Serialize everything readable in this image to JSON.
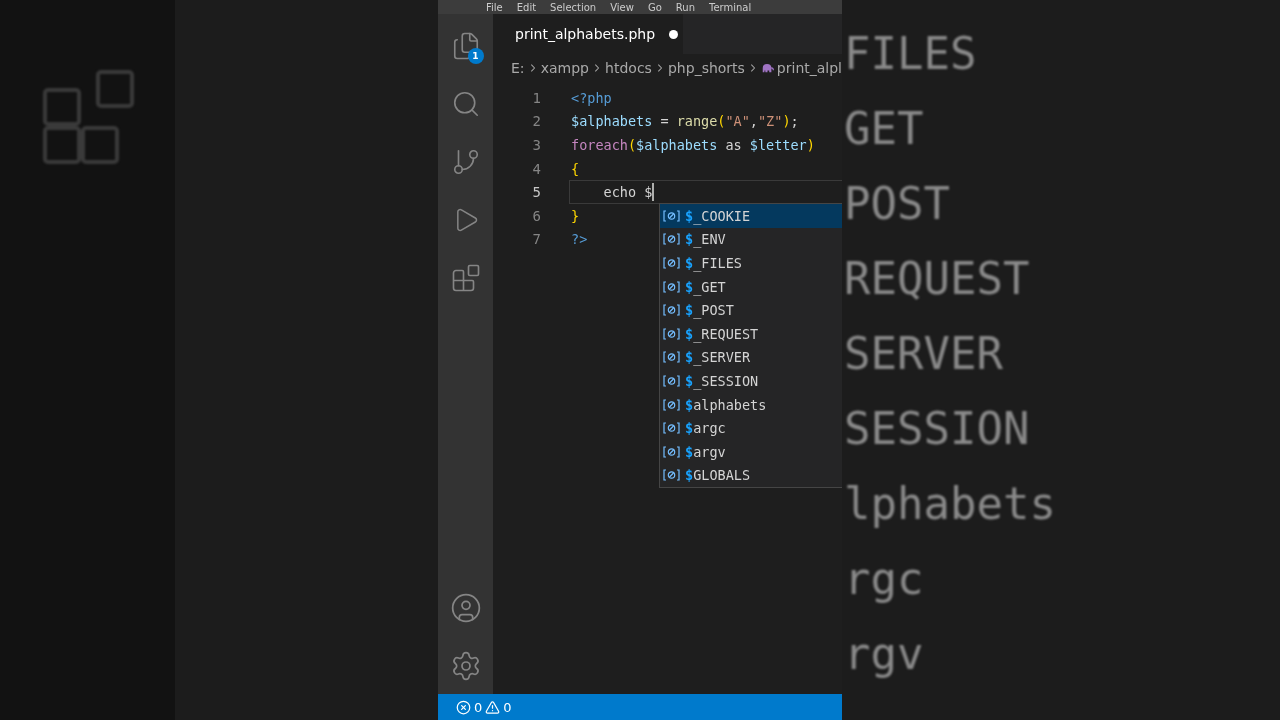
{
  "menu": [
    "File",
    "Edit",
    "Selection",
    "View",
    "Go",
    "Run",
    "Terminal"
  ],
  "activity_bar": {
    "explorer_badge": "1"
  },
  "tab": {
    "title": "print_alphabets.php",
    "modified": true
  },
  "breadcrumb": [
    "E:",
    "xampp",
    "htdocs",
    "php_shorts",
    "print_alpl"
  ],
  "code": [
    {
      "number": "1",
      "current": false,
      "tokens": [
        {
          "kind": "tag",
          "text": "<?php"
        }
      ]
    },
    {
      "number": "2",
      "current": false,
      "tokens": [
        {
          "kind": "var",
          "text": "$alphabets"
        },
        {
          "kind": "plain",
          "text": " = "
        },
        {
          "kind": "fn",
          "text": "range"
        },
        {
          "kind": "brace",
          "text": "("
        },
        {
          "kind": "str",
          "text": "\"A\""
        },
        {
          "kind": "plain",
          "text": ","
        },
        {
          "kind": "str",
          "text": "\"Z\""
        },
        {
          "kind": "brace",
          "text": ")"
        },
        {
          "kind": "plain",
          "text": ";"
        }
      ]
    },
    {
      "number": "3",
      "current": false,
      "tokens": [
        {
          "kind": "kw",
          "text": "foreach"
        },
        {
          "kind": "brace",
          "text": "("
        },
        {
          "kind": "var",
          "text": "$alphabets"
        },
        {
          "kind": "plain",
          "text": " as "
        },
        {
          "kind": "var",
          "text": "$letter"
        },
        {
          "kind": "brace",
          "text": ")"
        }
      ]
    },
    {
      "number": "4",
      "current": false,
      "tokens": [
        {
          "kind": "brace",
          "text": "{"
        }
      ]
    },
    {
      "number": "5",
      "current": true,
      "tokens": [
        {
          "kind": "plain",
          "text": "    echo $"
        }
      ]
    },
    {
      "number": "6",
      "current": false,
      "tokens": [
        {
          "kind": "brace",
          "text": "}"
        }
      ]
    },
    {
      "number": "7",
      "current": false,
      "tokens": [
        {
          "kind": "tag",
          "text": "?>"
        }
      ]
    }
  ],
  "suggestions": [
    {
      "label": "$_COOKIE",
      "selected": true
    },
    {
      "label": "$_ENV",
      "selected": false
    },
    {
      "label": "$_FILES",
      "selected": false
    },
    {
      "label": "$_GET",
      "selected": false
    },
    {
      "label": "$_POST",
      "selected": false
    },
    {
      "label": "$_REQUEST",
      "selected": false
    },
    {
      "label": "$_SERVER",
      "selected": false
    },
    {
      "label": "$_SESSION",
      "selected": false
    },
    {
      "label": "$alphabets",
      "selected": false
    },
    {
      "label": "$argc",
      "selected": false
    },
    {
      "label": "$argv",
      "selected": false
    },
    {
      "label": "$GLOBALS",
      "selected": false
    }
  ],
  "status_bar": {
    "errors": "0",
    "warnings": "0"
  },
  "backdrop_right": [
    "FILES",
    "GET",
    "POST",
    "REQUEST",
    "SERVER",
    "SESSION",
    "lphabets",
    "rgc",
    "rgv"
  ]
}
